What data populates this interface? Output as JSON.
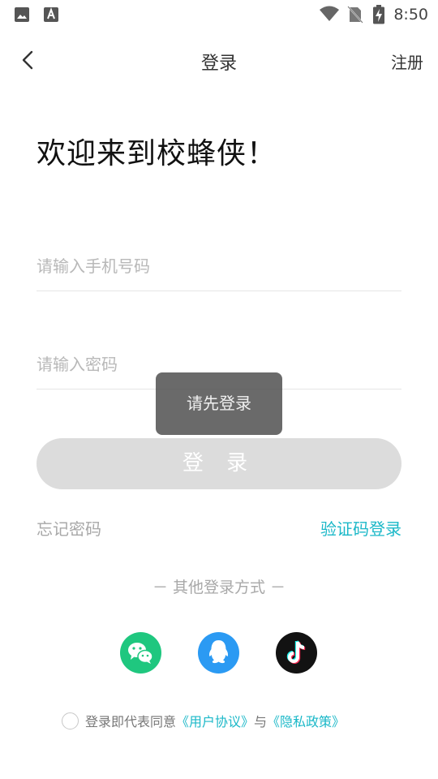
{
  "status_bar": {
    "time": "8:50",
    "icons": [
      "image-icon",
      "accessibility-a-icon",
      "wifi-icon",
      "no-sim-icon",
      "battery-charging-icon"
    ]
  },
  "nav": {
    "title": "登录",
    "back_icon": "chevron-left-icon",
    "register_label": "注册"
  },
  "welcome_text": "欢迎来到校蜂侠！",
  "form": {
    "phone_placeholder": "请输入手机号码",
    "phone_value": "",
    "password_placeholder": "请输入密码",
    "password_value": "",
    "login_button_label": "登 录"
  },
  "toast": {
    "text": "请先登录"
  },
  "links": {
    "forgot_password": "忘记密码",
    "code_login": "验证码登录"
  },
  "other_login": {
    "title": "－ 其他登录方式 －",
    "providers": [
      {
        "name": "wechat",
        "icon": "wechat-icon",
        "color": "#1fc77f"
      },
      {
        "name": "qq",
        "icon": "qq-icon",
        "color": "#2b9af3"
      },
      {
        "name": "tiktok",
        "icon": "tiktok-icon",
        "color": "#121212"
      }
    ]
  },
  "agreement": {
    "prefix": "登录即代表同意",
    "user_agreement": "《用户协议》",
    "conjunction": "与",
    "privacy_policy": "《隐私政策》",
    "checked": false
  },
  "colors": {
    "accent": "#1bb8c8",
    "button_disabled": "#dcdcdc",
    "toast_bg": "#505050"
  }
}
